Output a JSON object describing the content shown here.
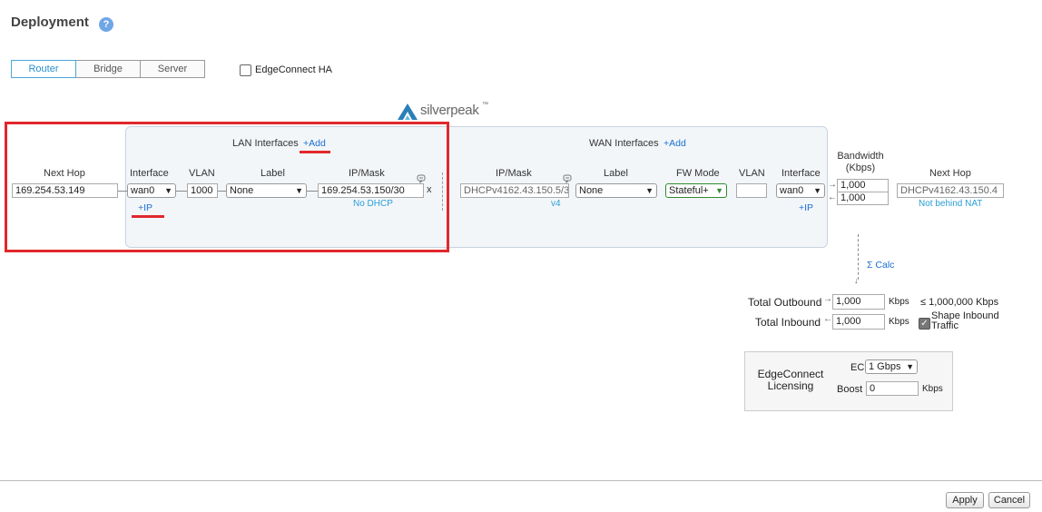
{
  "header": {
    "title": "Deployment",
    "help_icon": "?"
  },
  "mode_tabs": [
    "Router",
    "Bridge",
    "Server"
  ],
  "ha": {
    "label": "EdgeConnect HA",
    "checked": false
  },
  "logo": {
    "text": "silverpeak",
    "tm": "™"
  },
  "lan": {
    "title": "LAN Interfaces",
    "add": "+Add",
    "cols": {
      "next_hop": "Next Hop",
      "interface": "Interface",
      "vlan": "VLAN",
      "label": "Label",
      "ipmask": "IP/Mask"
    },
    "next_hop": "169.254.53.149",
    "interface": "wan0",
    "vlan": "1000",
    "label": "None",
    "ipmask": "169.254.53.150/30",
    "dhcp": "No DHCP",
    "add_ip": "+IP",
    "remove": "x"
  },
  "wan": {
    "title": "WAN Interfaces",
    "add": "+Add",
    "cols": {
      "ipmask": "IP/Mask",
      "label": "Label",
      "fw_mode": "FW Mode",
      "vlan": "VLAN",
      "interface": "Interface",
      "bandwidth": "Bandwidth\n(Kbps)",
      "next_hop": "Next Hop"
    },
    "ipmask": "DHCPv4162.43.150.5/3",
    "ip_version": "v4",
    "label": "None",
    "fw_mode": "Stateful+",
    "vlan": "",
    "interface": "wan0",
    "add_ip": "+IP",
    "bw_out": "1,000",
    "bw_in": "1,000",
    "next_hop": "DHCPv4162.43.150.4",
    "nat": "Not behind NAT"
  },
  "calc": {
    "label": "Σ Calc"
  },
  "totals": {
    "outbound_label": "Total Outbound",
    "outbound": "1,000",
    "inbound_label": "Total Inbound",
    "inbound": "1,000",
    "unit": "Kbps",
    "limit": "≤ 1,000,000 Kbps",
    "shape_label": "Shape Inbound Traffic",
    "shape_checked": true
  },
  "licensing": {
    "title": "EdgeConnect\nLicensing",
    "ec_label": "EC",
    "ec_value": "1 Gbps",
    "boost_label": "Boost",
    "boost_value": "0",
    "unit": "Kbps"
  },
  "footer": {
    "apply": "Apply",
    "cancel": "Cancel"
  },
  "colors": {
    "accent": "#2a8fd0",
    "highlight": "#e0282c",
    "link": "#1a6fd1"
  }
}
